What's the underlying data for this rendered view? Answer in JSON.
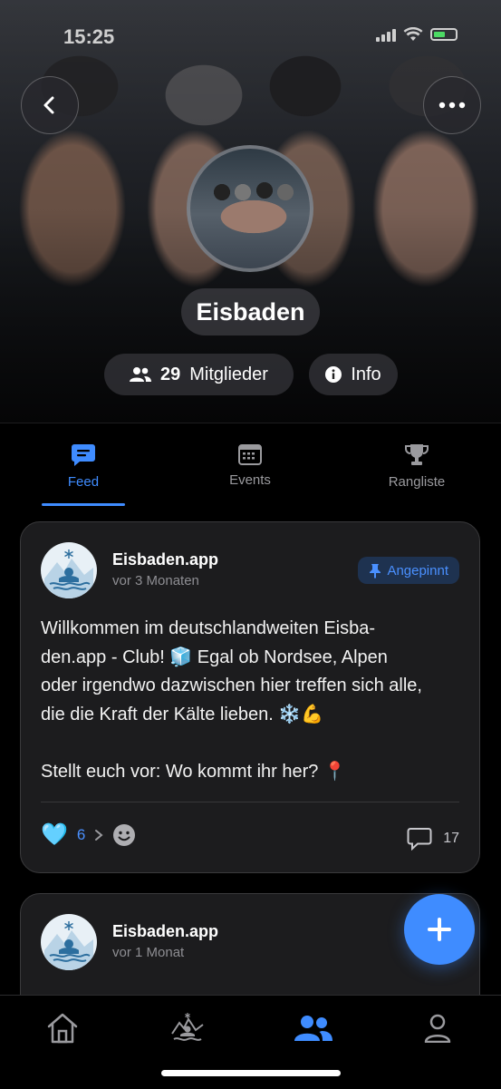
{
  "status_bar": {
    "time": "15:25"
  },
  "header": {
    "group_name": "Eisbaden",
    "members_count": "29",
    "members_label": "Mitglieder",
    "info_label": "Info"
  },
  "tabs": [
    {
      "label": "Feed",
      "icon": "chat-bubble-icon",
      "active": true
    },
    {
      "label": "Events",
      "icon": "calendar-icon",
      "active": false
    },
    {
      "label": "Rangliste",
      "icon": "trophy-icon",
      "active": false
    }
  ],
  "posts": [
    {
      "author": "Eisbaden.app",
      "time": "vor 3 Monaten",
      "pinned_label": "Angepinnt",
      "lines": [
        "Willkommen im deutschlandweiten Eisba-",
        "den.app - Club! 🧊  Egal ob Nordsee, Alpen",
        "oder irgendwo dazwischen hier treffen sich alle,",
        "die die Kraft der Kälte lieben. ❄️💪",
        "",
        "Stellt euch vor: Wo kommt ihr her? 📍"
      ],
      "like_emoji": "🩵",
      "like_count": "6",
      "comment_count": "17"
    },
    {
      "author": "Eisbaden.app",
      "time": "vor 1 Monat"
    }
  ],
  "colors": {
    "accent": "#3f8cff",
    "card_bg": "#1c1c1e",
    "background": "#000000"
  }
}
